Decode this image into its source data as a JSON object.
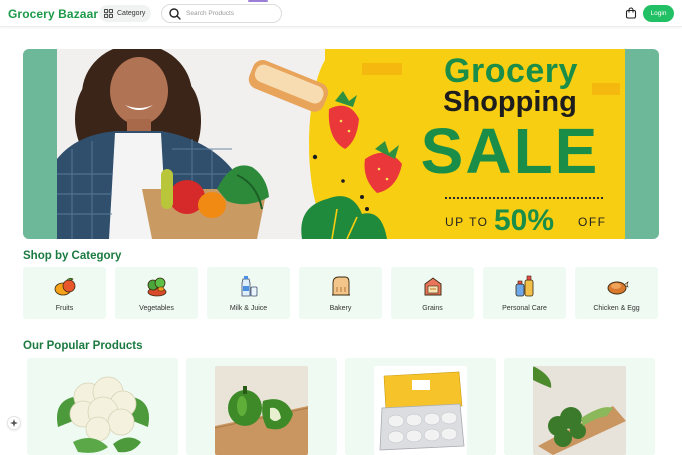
{
  "header": {
    "brand": "Grocery Bazaar",
    "category_label": "Category",
    "search_placeholder": "Search Products",
    "login_label": "Login",
    "accent_color": "#22c064",
    "brand_color": "#1c9a4a"
  },
  "banner": {
    "line1": "Grocery",
    "line2": "Shopping",
    "line3": "SALE",
    "upto": "UP TO",
    "percent": "50%",
    "off": "OFF"
  },
  "categories": {
    "title": "Shop by Category",
    "items": [
      {
        "label": "Fruits",
        "icon": "fruits-icon"
      },
      {
        "label": "Vegetables",
        "icon": "vegetables-icon"
      },
      {
        "label": "Milk & Juice",
        "icon": "milk-juice-icon"
      },
      {
        "label": "Bakery",
        "icon": "bakery-icon"
      },
      {
        "label": "Grains",
        "icon": "grains-icon"
      },
      {
        "label": "Personal Care",
        "icon": "personal-care-icon"
      },
      {
        "label": "Chicken & Egg",
        "icon": "chicken-egg-icon"
      }
    ]
  },
  "products": {
    "title": "Our Popular Products",
    "items": [
      {
        "image": "cauliflower"
      },
      {
        "image": "green-capsicum"
      },
      {
        "image": "eggs-tray"
      },
      {
        "image": "broccoli"
      }
    ]
  }
}
